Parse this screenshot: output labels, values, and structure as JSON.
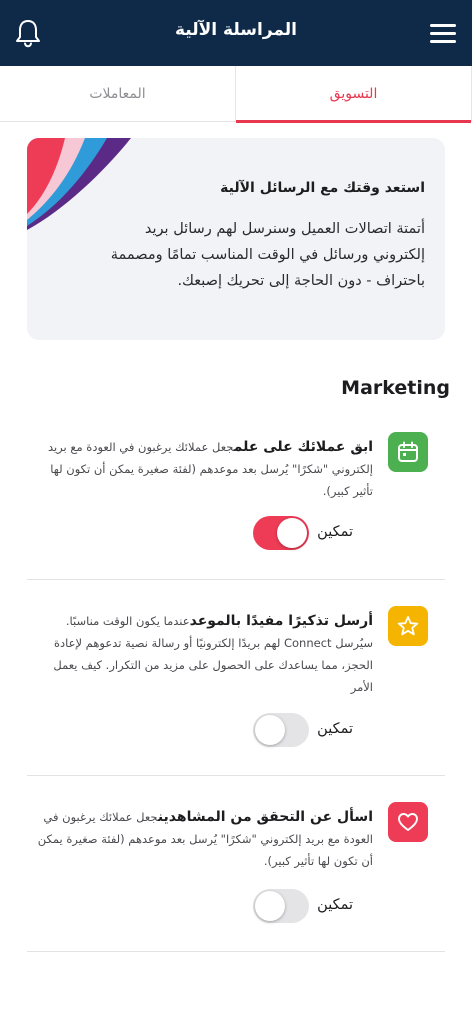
{
  "header": {
    "title": "المراسلة الآلية",
    "bell_icon": "bell-icon",
    "menu_icon": "hamburger-menu-icon",
    "bg_color": "#0f2a49"
  },
  "tabs": [
    {
      "label": "المعاملات",
      "active": false
    },
    {
      "label": "التسويق",
      "active": true
    }
  ],
  "accent_color": "#e8384f",
  "banner": {
    "heading": "استعد وقتك مع الرسائل الآلية",
    "text": "أتمتة اتصالات العميل وسنرسل لهم رسائل بريد إلكتروني ورسائل في الوقت المناسب تمامًا ومصممة باحتراف - دون الحاجة إلى تحريك إصبعك."
  },
  "section": {
    "title": "Marketing"
  },
  "cards": [
    {
      "icon": "calendar-icon",
      "icon_color": "#4caf50",
      "title": "ابق عملائك على علم",
      "description": "جعل عملائك يرغبون في العودة مع بريد إلكتروني \"شكرًا\" يُرسل بعد موعدهم (لفئة صغيرة يمكن أن تكون لها تأثير كبير).",
      "toggle_label": "تمكين",
      "enabled": true
    },
    {
      "icon": "star-icon",
      "icon_color": "#f5b400",
      "title": "أرسل تذكيرًا مفيدًا بالموعد",
      "description": "عندما يكون الوقت مناسبًا. سيُرسل Connect لهم بريدًا إلكترونيًا أو رسالة نصية تدعوهم لإعادة الحجز، مما يساعدك على الحصول على مزيد من التكرار. كيف يعمل الأمر",
      "toggle_label": "تمكين",
      "enabled": false
    },
    {
      "icon": "heart-icon",
      "icon_color": "#ef3c56",
      "title": "اسأل عن التحقق من المشاهدين",
      "description": "جعل عملائك يرغبون في العودة مع بريد إلكتروني \"شكرًا\" يُرسل بعد موعدهم (لفئة صغيرة يمكن أن تكون لها تأثير كبير).",
      "toggle_label": "تمكين",
      "enabled": false
    }
  ]
}
